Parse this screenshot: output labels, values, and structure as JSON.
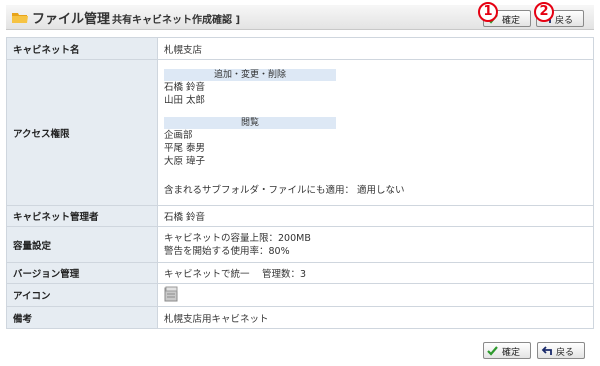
{
  "header": {
    "title": "ファイル管理",
    "subtitle": "[ 共有キャビネット作成確認 ]"
  },
  "buttons": {
    "confirm": "確定",
    "back": "戻る"
  },
  "annotations": {
    "one": "1",
    "two": "2"
  },
  "form": {
    "cabinet_name": {
      "label": "キャビネット名",
      "value": "札幌支店"
    },
    "access": {
      "label": "アクセス権限",
      "edit_group": {
        "heading": "追加・変更・削除",
        "users": [
          "石橋 鈴音",
          "山田 太郎"
        ]
      },
      "view_group": {
        "heading": "閲覧",
        "users": [
          "企画部",
          "平尾 泰男",
          "大原 瑋子"
        ]
      },
      "subfolder_note": "含まれるサブフォルダ・ファイルにも適用：  適用しない"
    },
    "admin": {
      "label": "キャビネット管理者",
      "value": "石橋 鈴音"
    },
    "capacity": {
      "label": "容量設定",
      "line1": "キャビネットの容量上限：200MB",
      "line2": "警告を開始する使用率：80%"
    },
    "version": {
      "label": "バージョン管理",
      "value": "キャビネットで統一　 管理数：3"
    },
    "icon": {
      "label": "アイコン",
      "icon_name": "cabinet-icon"
    },
    "note": {
      "label": "備考",
      "value": "札幌支店用キャビネット"
    }
  },
  "colors": {
    "label_bg": "#e6ecf2",
    "group_head_bg": "#dde8f5",
    "annotation": "#e60012",
    "check": "#2e9a2e"
  }
}
